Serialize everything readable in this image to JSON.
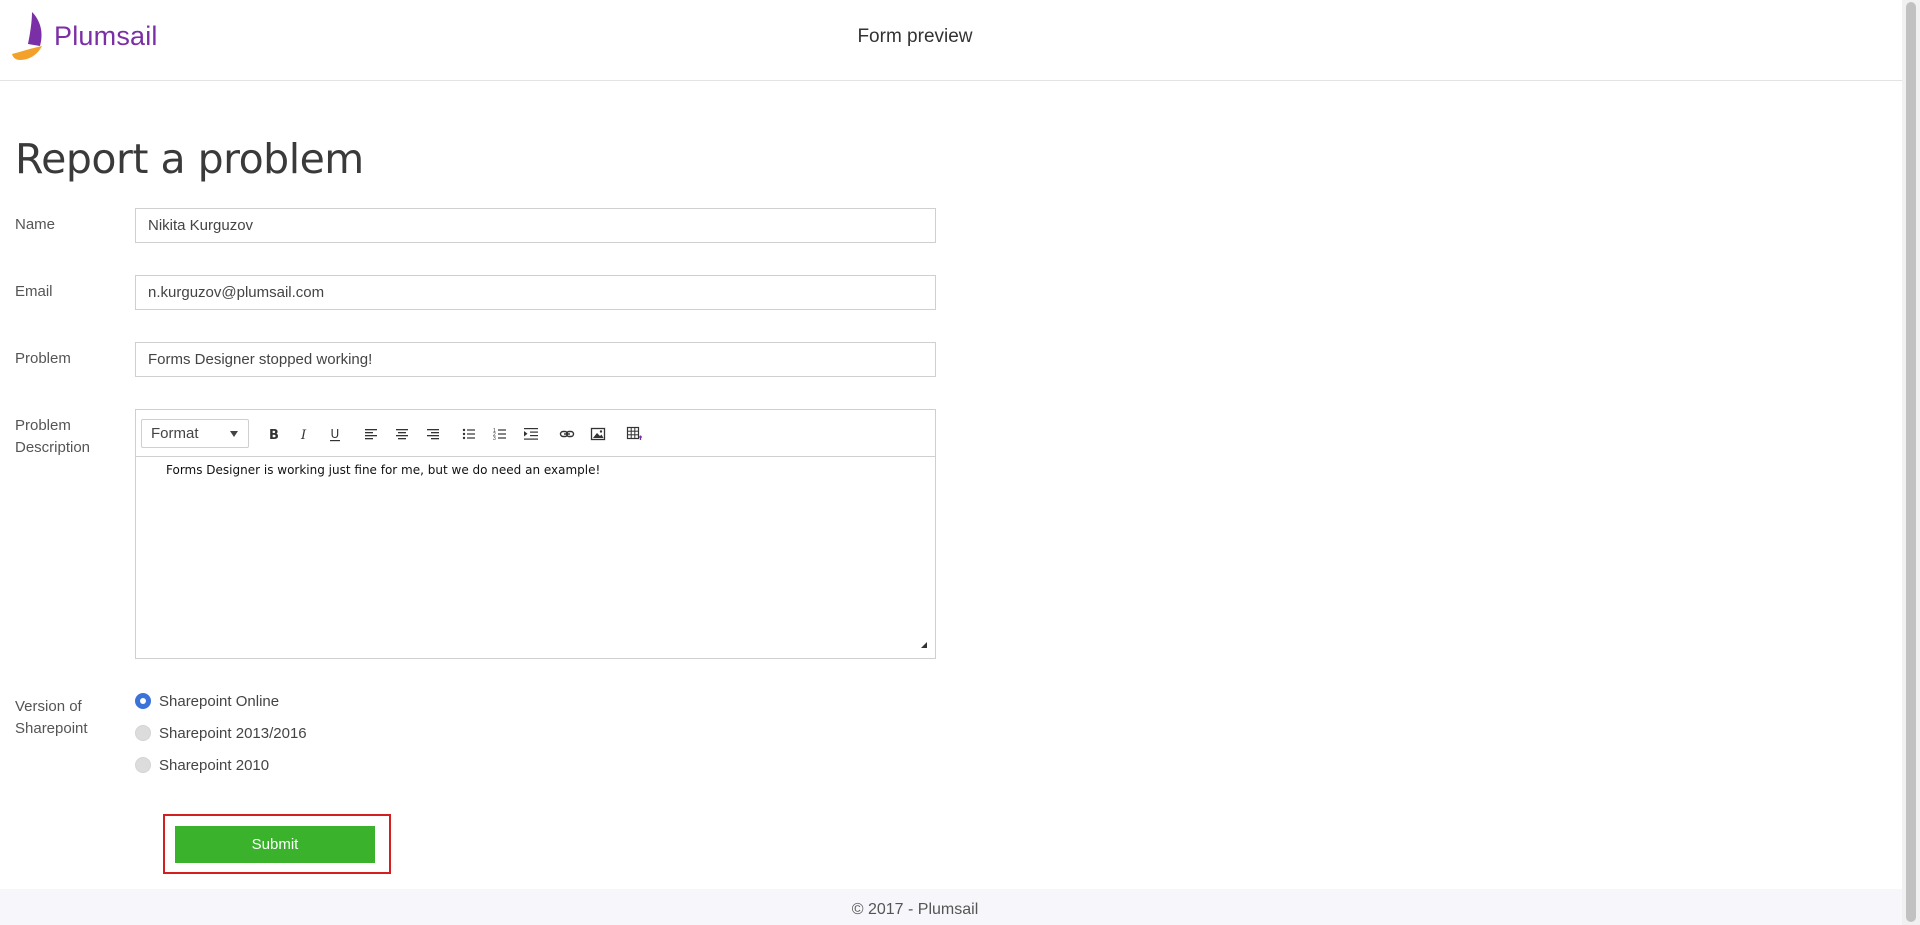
{
  "header": {
    "brand": "Plumsail",
    "title": "Form preview"
  },
  "form": {
    "title": "Report a problem",
    "fields": {
      "name": {
        "label": "Name",
        "value": "Nikita Kurguzov"
      },
      "email": {
        "label": "Email",
        "value": "n.kurguzov@plumsail.com"
      },
      "problem": {
        "label": "Problem",
        "value": "Forms Designer stopped working!"
      },
      "description": {
        "label_line1": "Problem",
        "label_line2": "Description",
        "content": "Forms Designer is working just fine for me, but we do need an example!"
      }
    },
    "toolbar": {
      "format_label": "Format",
      "buttons": [
        "bold-icon",
        "italic-icon",
        "underline-icon",
        "align-left-icon",
        "align-center-icon",
        "align-right-icon",
        "bullet-list-icon",
        "numbered-list-icon",
        "indent-icon",
        "link-icon",
        "image-icon",
        "table-icon"
      ]
    },
    "version": {
      "label_line1": "Version of",
      "label_line2": "Sharepoint",
      "options": [
        {
          "label": "Sharepoint Online",
          "selected": true
        },
        {
          "label": "Sharepoint 2013/2016",
          "selected": false
        },
        {
          "label": "Sharepoint 2010",
          "selected": false
        }
      ]
    },
    "submit_label": "Submit"
  },
  "footer": {
    "text": "© 2017 - Plumsail"
  },
  "colors": {
    "brand_purple": "#7b2fa6",
    "brand_orange": "#f4a12b",
    "submit_green": "#3ab22c",
    "highlight_red": "#d21f1f",
    "radio_blue": "#3b73d8"
  }
}
